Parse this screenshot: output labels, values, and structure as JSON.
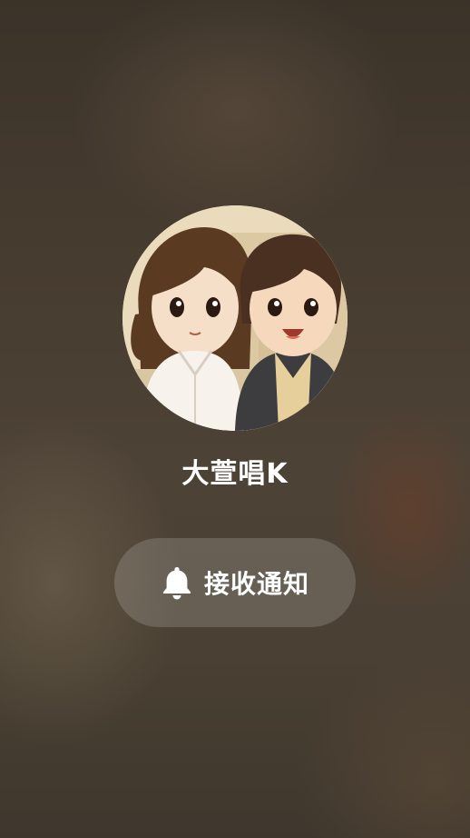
{
  "profile": {
    "username": "大萱唱K",
    "avatar_icon": "couple-cartoon-avatar"
  },
  "notify_button": {
    "label": "接收通知",
    "icon": "bell-icon"
  },
  "colors": {
    "text": "#ffffff",
    "button_bg": "rgba(255,255,255,0.16)"
  }
}
